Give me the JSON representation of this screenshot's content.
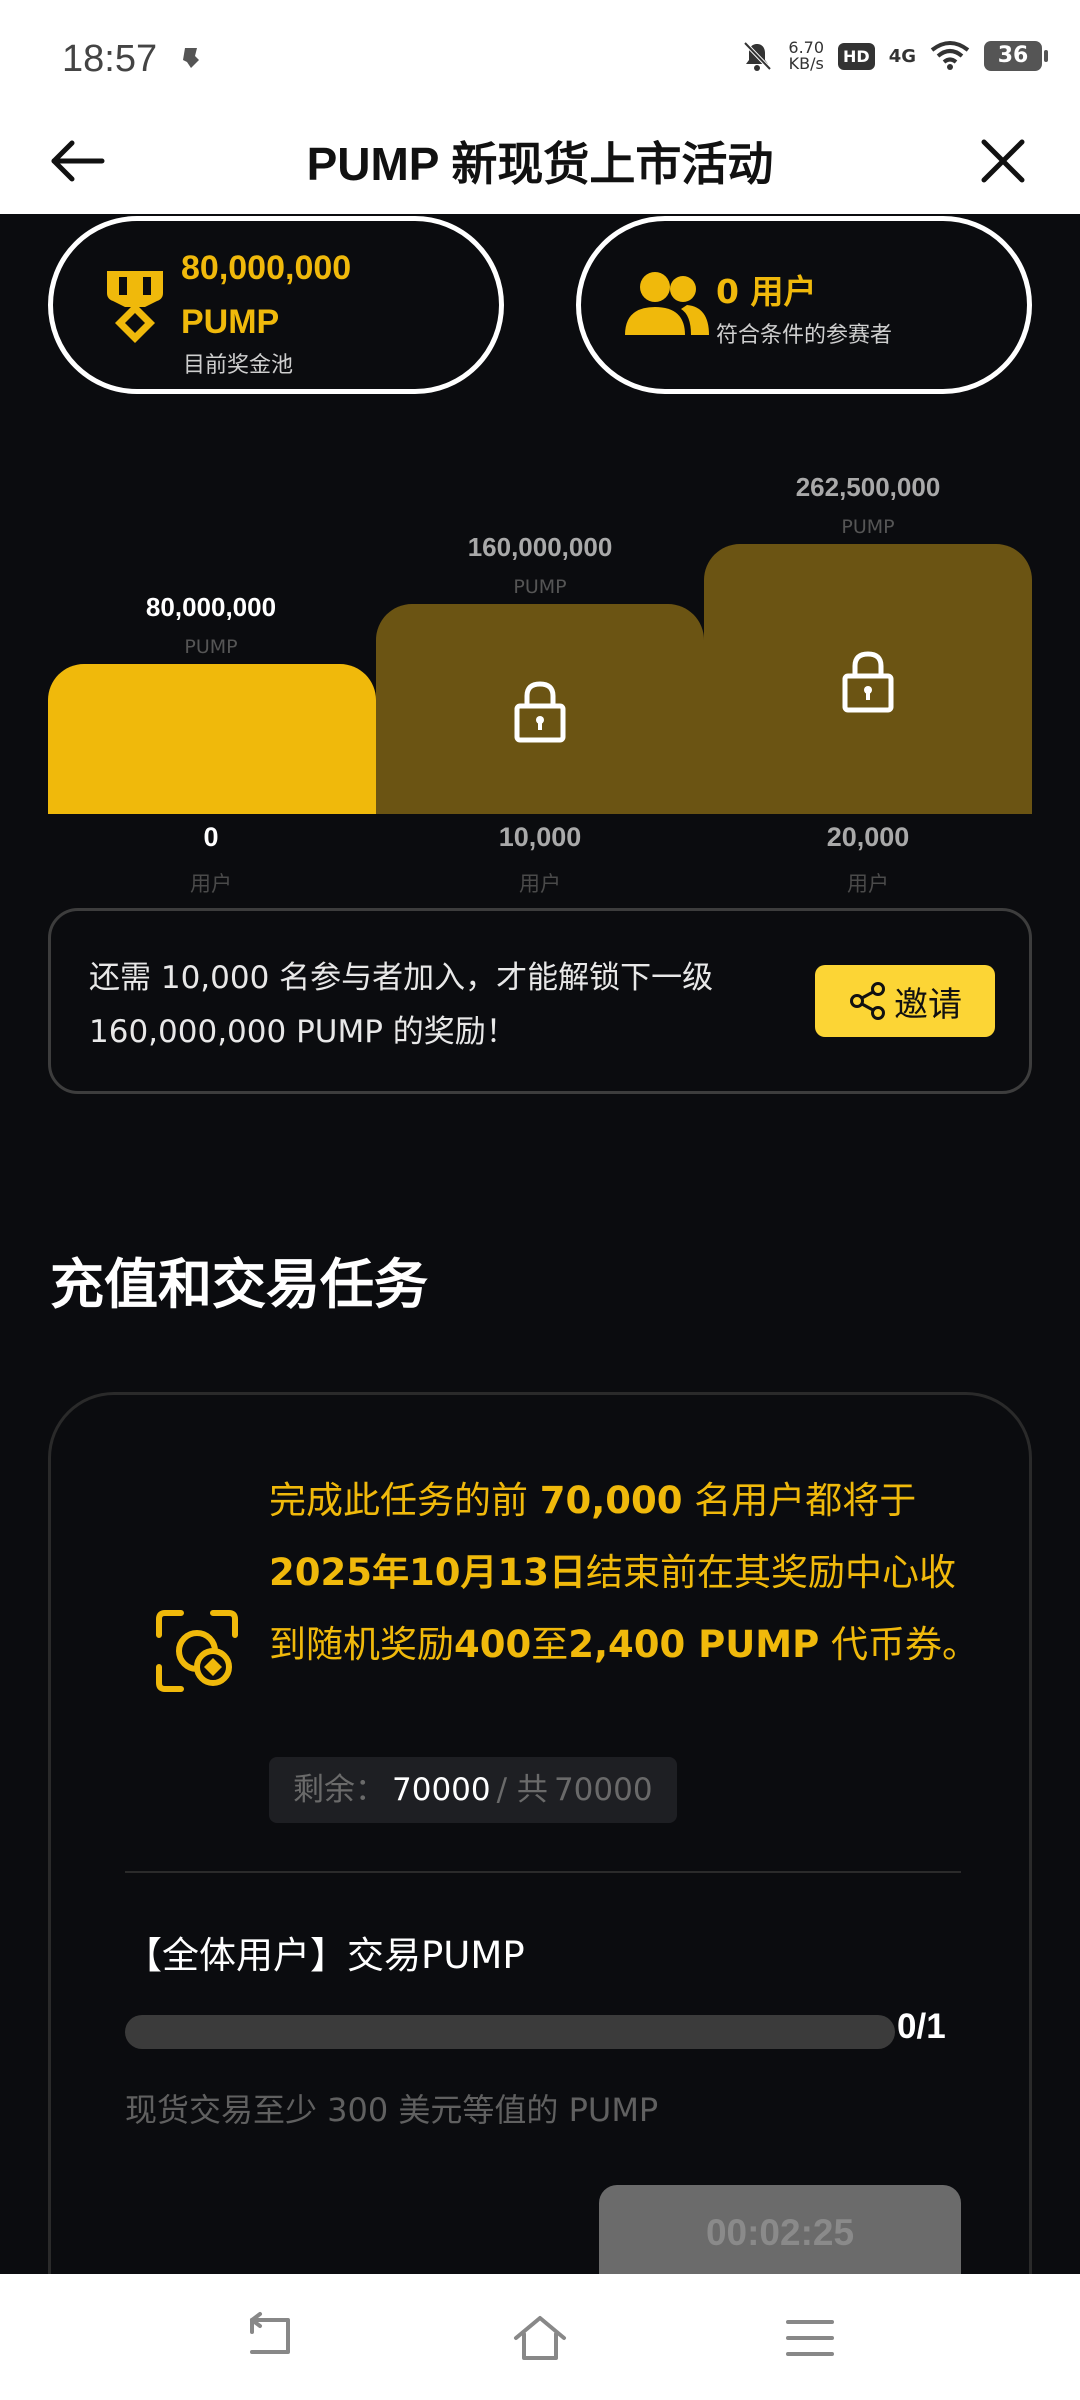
{
  "status_bar": {
    "time": "18:57",
    "speed_value": "6.70",
    "speed_unit": "KB/s",
    "hd": "HD",
    "network": "4G",
    "battery": "36"
  },
  "header": {
    "title": "PUMP 新现货上市活动"
  },
  "pool": {
    "amount": "80,000,000",
    "unit": "PUMP",
    "label": "目前奖金池"
  },
  "participants": {
    "count": "0 用户",
    "label": "符合条件的参赛者"
  },
  "tiers": [
    {
      "reward": "80,000,000",
      "reward_unit": "PUMP",
      "threshold": "0",
      "threshold_unit": "用户",
      "locked": false
    },
    {
      "reward": "160,000,000",
      "reward_unit": "PUMP",
      "threshold": "10,000",
      "threshold_unit": "用户",
      "locked": true
    },
    {
      "reward": "262,500,000",
      "reward_unit": "PUMP",
      "threshold": "20,000",
      "threshold_unit": "用户",
      "locked": true
    }
  ],
  "invite": {
    "text_line1": "还需 10,000 名参与者加入，才能解锁下一级",
    "text_line2": "160,000,000 PUMP 的奖励！",
    "button_label": "邀请"
  },
  "section": {
    "title": "充值和交易任务"
  },
  "task": {
    "desc_p1": "完成此任务的前 ",
    "desc_b1": "70,000",
    "desc_p2": " 名用户都将于 ",
    "desc_b2": "2025年10月13日",
    "desc_p3": "结束前在其奖励中心收到随机奖励",
    "desc_b3": "400",
    "desc_p4": "至",
    "desc_b4": "2,400 PUMP",
    "desc_p5": " 代币券。",
    "remain_label": "剩余：",
    "remain_current": "70000",
    "remain_sep": " / 共 ",
    "remain_total": "70000",
    "subtask_title": "【全体用户】交易PUMP",
    "progress": 0,
    "progress_text": "0/1",
    "requirement": "现货交易至少 300 美元等值的 PUMP",
    "timer": "00:02:25"
  },
  "colors": {
    "accent": "#f0b90b",
    "button_yellow": "#fcd535",
    "locked_bar": "#6b5413",
    "background": "#0b0c0f"
  }
}
